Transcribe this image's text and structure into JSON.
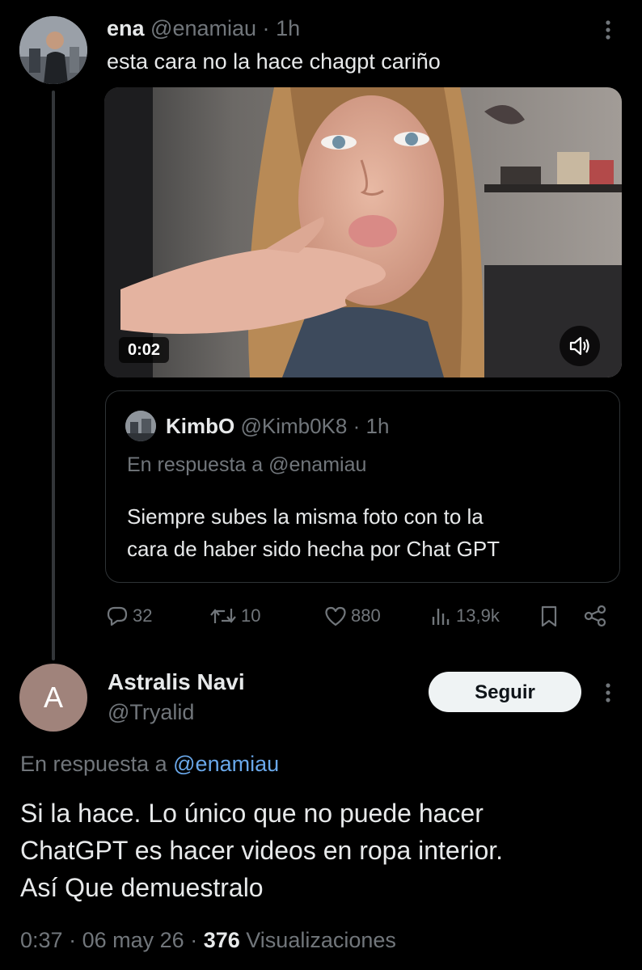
{
  "tweet1": {
    "display_name": "ena",
    "handle": "@enamiau",
    "separator": "·",
    "time": "1h",
    "text": "esta cara no la hace chagpt cariño",
    "video": {
      "duration": "0:02"
    },
    "quote": {
      "display_name": "KimbO",
      "handle": "@Kimb0K8",
      "separator": "·",
      "time": "1h",
      "reply_prefix": "En respuesta a",
      "reply_to": "@enamiau",
      "line1": "Siempre subes la misma foto con to la",
      "line2": "cara de haber sido hecha por Chat GPT"
    },
    "actions": {
      "replies": "32",
      "retweets": "10",
      "likes": "880",
      "views": "13,9k"
    }
  },
  "tweet2": {
    "avatar_letter": "A",
    "display_name": "Astralis Navi",
    "handle": "@Tryalid",
    "follow_label": "Seguir",
    "reply_prefix": "En respuesta a",
    "reply_to": "@enamiau",
    "line1": "Si la hace. Lo único que no puede hacer",
    "line2": "ChatGPT es hacer videos en ropa interior.",
    "line3": "Así Que demuestralo",
    "time": "0:37",
    "sep1": "·",
    "date": "06 may 26",
    "sep2": "·",
    "views": "376",
    "views_label": "Visualizaciones"
  },
  "icons": {
    "more": "more-vertical-icon",
    "reply": "reply-icon",
    "retweet": "retweet-icon",
    "like": "heart-icon",
    "views": "views-bars-icon",
    "bookmark": "bookmark-icon",
    "share": "share-icon",
    "volume": "volume-muted-icon"
  },
  "colors": {
    "background": "#000000",
    "text": "#e7e9ea",
    "muted": "#71767b",
    "mention": "#6aa8ea",
    "follow_bg": "#eff3f4"
  }
}
